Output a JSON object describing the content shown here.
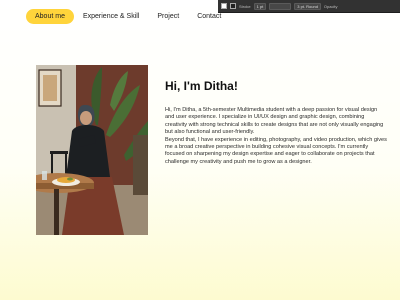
{
  "nav": {
    "items": [
      "About me",
      "Experience & Skill",
      "Project",
      "Contact"
    ]
  },
  "app_bar": {
    "stroke_label": "Stroke",
    "stroke_value": "1 pt",
    "brush_value": "3 pt. Round",
    "opacity_label": "Opacity"
  },
  "hero": {
    "title": "Hi, I'm Ditha!",
    "paragraph_1": "Hi, I'm Ditha, a 5th-semester Multimedia student with a deep passion for visual design and user experience. I specialize in UI/UX design and graphic design, combining creativity with strong technical skills to create designs that are not only visually engaging but also functional and user-friendly.",
    "paragraph_2": "Beyond that, I have experience in editing, photography, and video production, which gives me a broad creative perspective in building cohesive visual concepts. I'm currently focused on sharpening my design expertise and eager to collaborate on projects that challenge my creativity and push me to grow as a designer."
  },
  "colors": {
    "accent": "#ffd43b",
    "page_bottom": "#fdfbd0",
    "app_chrome": "#323232"
  }
}
